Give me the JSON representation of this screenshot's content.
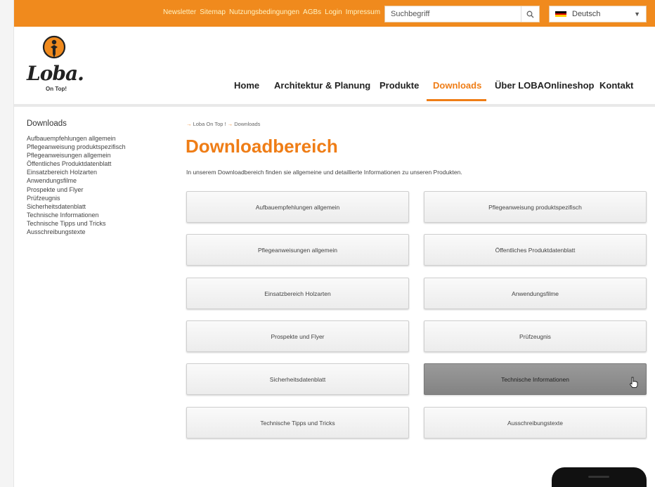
{
  "topbar": {
    "links": [
      "Newsletter",
      "Sitemap",
      "Nutzungsbedingungen",
      "AGBs",
      "Login",
      "Impressum"
    ],
    "search_placeholder": "Suchbegriff",
    "search_icon": "search-icon",
    "language": "Deutsch",
    "language_flag_colors": [
      "#000000",
      "#dd0000",
      "#ffce00"
    ]
  },
  "logo": {
    "wordmark": "Loba.",
    "tagline": "On Top!"
  },
  "nav": {
    "items": [
      "Home",
      "Architektur & Planung",
      "Produkte",
      "Downloads",
      "Über LOBA",
      "Onlineshop",
      "Kontakt"
    ],
    "active": "Downloads"
  },
  "sidebar": {
    "title": "Downloads",
    "items": [
      "Aufbauempfehlungen allgemein",
      "Pflegeanweisung produktspezifisch",
      "Pflegeanweisungen allgemein",
      "Öffentliches Produktdatenblatt",
      "Einsatzbereich Holzarten",
      "Anwendungsfilme",
      "Prospekte und Flyer",
      "Prüfzeugnis",
      "Sicherheitsdatenblatt",
      "Technische Informationen",
      "Technische Tipps und Tricks",
      "Ausschreibungstexte"
    ]
  },
  "main": {
    "breadcrumb": [
      "Loba On Top !",
      "Downloads"
    ],
    "breadcrumb_arrow": "→",
    "title": "Downloadbereich",
    "intro": "In unserem Downloadbereich finden sie allgemeine und detaillierte Informationen zu unseren Produkten.",
    "tiles": [
      "Aufbauempfehlungen allgemein",
      "Pflegeanweisung produktspezifisch",
      "Pflegeanweisungen allgemein",
      "Öffentliches Produktdatenblatt",
      "Einsatzbereich Holzarten",
      "Anwendungsfilme",
      "Prospekte und Flyer",
      "Prüfzeugnis",
      "Sicherheitsdatenblatt",
      "Technische Informationen",
      "Technische Tipps und Tricks",
      "Ausschreibungstexte"
    ],
    "hovered_tile": "Technische Informationen"
  },
  "colors": {
    "accent": "#ef7d16",
    "topbar": "#f08a1d"
  }
}
